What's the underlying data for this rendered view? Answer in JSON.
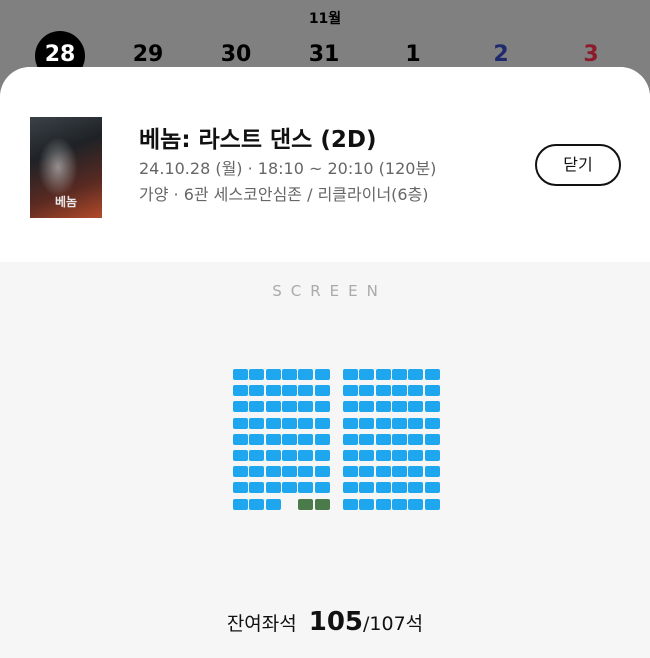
{
  "calendar": {
    "month": "11월",
    "dates": [
      {
        "label": "28",
        "selected": true,
        "color": "#ffffff"
      },
      {
        "label": "29",
        "selected": false,
        "color": "#000000"
      },
      {
        "label": "30",
        "selected": false,
        "color": "#000000"
      },
      {
        "label": "31",
        "selected": false,
        "color": "#000000"
      },
      {
        "label": "1",
        "selected": false,
        "color": "#000000"
      },
      {
        "label": "2",
        "selected": false,
        "color": "#1f2a6e"
      },
      {
        "label": "3",
        "selected": false,
        "color": "#8c1c2c"
      }
    ]
  },
  "movie": {
    "title": "베놈: 라스트 댄스 (2D)",
    "schedule": "24.10.28 (월) · 18:10 ~ 20:10 (120분)",
    "venue": "가양 · 6관 세스코안심존 / 리클라이너(6층)",
    "poster_text": "베놈"
  },
  "close_label": "닫기",
  "screen_label": "SCREEN",
  "seating": {
    "rows": 9,
    "left_block_cols": 6,
    "right_block_cols": 6,
    "last_row_left_seats": [
      true,
      true,
      true,
      false,
      "reserved",
      "reserved"
    ],
    "available_color": "#1ea7ee",
    "reserved_color": "#4b7a4b"
  },
  "remaining": {
    "label": "잔여좌석",
    "count": "105",
    "total": "/107석"
  }
}
